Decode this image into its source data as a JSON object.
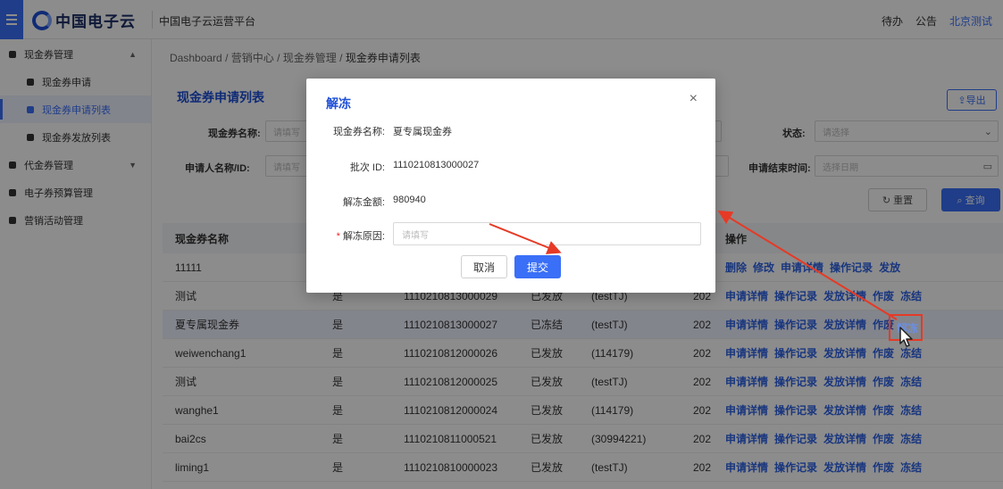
{
  "app": {
    "brand": "中国电子云",
    "platform": "中国电子云运营平台",
    "top_links": [
      "待办",
      "公告",
      "北京测试"
    ]
  },
  "sidebar": {
    "items": [
      {
        "label": "现金券管理",
        "level": 1,
        "arrow": "▲"
      },
      {
        "label": "现金券申请",
        "level": 2
      },
      {
        "label": "现金券申请列表",
        "level": 2,
        "active": true
      },
      {
        "label": "现金券发放列表",
        "level": 2
      },
      {
        "label": "代金券管理",
        "level": 1,
        "arrow": "▼"
      },
      {
        "label": "电子券预算管理",
        "level": 1
      },
      {
        "label": "营销活动管理",
        "level": 1
      }
    ]
  },
  "breadcrumb": {
    "items": [
      "Dashboard",
      "营销中心",
      "现金券管理"
    ],
    "current": "现金券申请列表",
    "separator": "/"
  },
  "page": {
    "title": "现金券申请列表",
    "export_label": "⇪导出",
    "filters": {
      "coupon_name_label": "现金券名称:",
      "coupon_name_placeholder": "请填写",
      "status_label": "状态:",
      "status_placeholder": "请选择",
      "applicant_label": "申请人名称/ID:",
      "applicant_placeholder": "请填写",
      "end_time_label": "申请结束时间:",
      "end_time_placeholder": "选择日期"
    },
    "reset_label": "↻ 重置",
    "query_label": "⌕ 查询"
  },
  "table": {
    "headers": {
      "name": "现金券名称",
      "ops": "操作"
    },
    "rows": [
      {
        "name": "11111",
        "flag": "",
        "batch": "",
        "status": "",
        "applicant": "",
        "date": "",
        "ops": [
          "删除",
          "修改",
          "申请详情",
          "操作记录",
          "发放"
        ]
      },
      {
        "name": "测试",
        "flag": "是",
        "batch": "1110210813000029",
        "status": "已发放",
        "applicant": "(testTJ)",
        "date": "202",
        "ops": [
          "申请详情",
          "操作记录",
          "发放详情",
          "作废",
          "冻结"
        ]
      },
      {
        "name": "夏专属现金券",
        "flag": "是",
        "batch": "1110210813000027",
        "status": "已冻结",
        "applicant": "(testTJ)",
        "date": "202",
        "ops": [
          "申请详情",
          "操作记录",
          "发放详情",
          "作废"
        ],
        "highlight": true
      },
      {
        "name": "weiwenchang1",
        "flag": "是",
        "batch": "1110210812000026",
        "status": "已发放",
        "applicant": "(114179)",
        "date": "202",
        "ops": [
          "申请详情",
          "操作记录",
          "发放详情",
          "作废",
          "冻结"
        ]
      },
      {
        "name": "测试",
        "flag": "是",
        "batch": "1110210812000025",
        "status": "已发放",
        "applicant": "(testTJ)",
        "date": "202",
        "ops": [
          "申请详情",
          "操作记录",
          "发放详情",
          "作废",
          "冻结"
        ]
      },
      {
        "name": "wanghe1",
        "flag": "是",
        "batch": "1110210812000024",
        "status": "已发放",
        "applicant": "(114179)",
        "date": "202",
        "ops": [
          "申请详情",
          "操作记录",
          "发放详情",
          "作废",
          "冻结"
        ]
      },
      {
        "name": "bai2cs",
        "flag": "是",
        "batch": "1110210811000521",
        "status": "已发放",
        "applicant": "(30994221)",
        "date": "202",
        "ops": [
          "申请详情",
          "操作记录",
          "发放详情",
          "作废",
          "冻结"
        ]
      },
      {
        "name": "liming1",
        "flag": "是",
        "batch": "1110210810000023",
        "status": "已发放",
        "applicant": "(testTJ)",
        "date": "202",
        "ops": [
          "申请详情",
          "操作记录",
          "发放详情",
          "作废",
          "冻结"
        ]
      }
    ]
  },
  "modal": {
    "title": "解冻",
    "close": "×",
    "coupon_name_label": "现金券名称:",
    "coupon_name_value": "夏专属现金券",
    "batch_id_label": "批次 ID:",
    "batch_id_value": "1110210813000027",
    "amount_label": "解冻金额:",
    "amount_value": "980940",
    "reason_required": "*",
    "reason_label": "解冻原因:",
    "reason_placeholder": "请填写",
    "cancel_label": "取消",
    "submit_label": "提交"
  },
  "annotation": {
    "highlighted_action": "解冻",
    "color": "#e63a26"
  }
}
